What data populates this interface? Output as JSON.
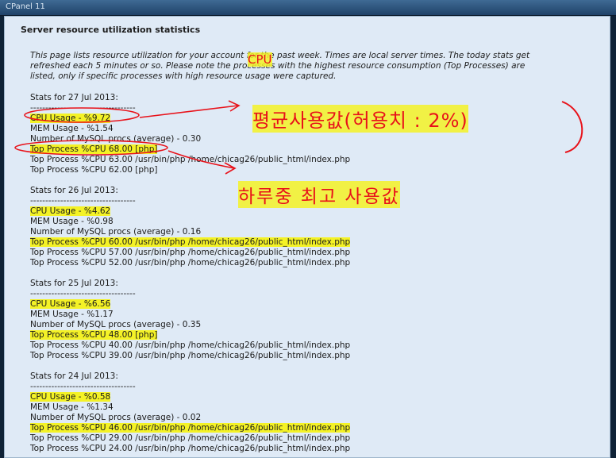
{
  "window": {
    "title": "CPanel 11"
  },
  "panel": {
    "title": "Server resource utilization statistics",
    "intro": [
      "This page lists resource utilization for your account for the past week. Times are local server times. The today stats get",
      "refreshed each 5 minutes or so. Please note the processes with the highest resource consumption (Top Processes) are",
      "listed, only if specific processes with high resource usage were captured."
    ]
  },
  "days": [
    {
      "header": "Stats for 27 Jul 2013:",
      "separator": "-----------------------------------",
      "cpu": "CPU Usage - %9.72",
      "mem": "MEM Usage - %1.54",
      "mysql": "Number of MySQL procs (average) - 0.30",
      "procs": [
        "Top Process %CPU 68.00 [php]",
        "Top Process %CPU 63.00 /usr/bin/php /home/chicag26/public_html/index.php",
        "Top Process %CPU 62.00 [php]"
      ]
    },
    {
      "header": "Stats for 26 Jul 2013:",
      "separator": "-----------------------------------",
      "cpu": "CPU Usage - %4.62",
      "mem": "MEM Usage - %0.98",
      "mysql": "Number of MySQL procs (average) - 0.16",
      "procs": [
        "Top Process %CPU 60.00 /usr/bin/php /home/chicag26/public_html/index.php",
        "Top Process %CPU 57.00 /usr/bin/php /home/chicag26/public_html/index.php",
        "Top Process %CPU 52.00 /usr/bin/php /home/chicag26/public_html/index.php"
      ]
    },
    {
      "header": "Stats for 25 Jul 2013:",
      "separator": "-----------------------------------",
      "cpu": "CPU Usage - %6.56",
      "mem": "MEM Usage - %1.17",
      "mysql": "Number of MySQL procs (average) - 0.35",
      "procs": [
        "Top Process %CPU 48.00 [php]",
        "Top Process %CPU 40.00 /usr/bin/php /home/chicag26/public_html/index.php",
        "Top Process %CPU 39.00 /usr/bin/php /home/chicag26/public_html/index.php"
      ]
    },
    {
      "header": "Stats for 24 Jul 2013:",
      "separator": "-----------------------------------",
      "cpu": "CPU Usage - %0.58",
      "mem": "MEM Usage - %1.34",
      "mysql": "Number of MySQL procs (average) - 0.02",
      "procs": [
        "Top Process %CPU 46.00 /usr/bin/php /home/chicag26/public_html/index.php",
        "Top Process %CPU 29.00 /usr/bin/php /home/chicag26/public_html/index.php",
        "Top Process %CPU 24.00 /usr/bin/php /home/chicag26/public_html/index.php"
      ]
    }
  ],
  "annotations": {
    "cpu_label": "CPU",
    "avg_usage": "평균사용값(허용치 : 2%)",
    "daily_peak": "하루중 최고 사용값",
    "color": "#e8121a",
    "highlight": "#f4f226"
  }
}
